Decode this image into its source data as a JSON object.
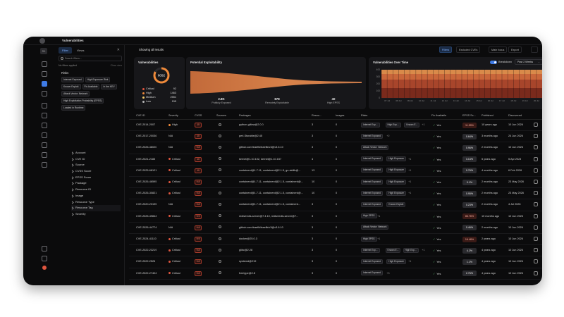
{
  "window": {
    "title": "Vulnerabilities"
  },
  "rail": {
    "badge": "S1"
  },
  "filters": {
    "tabs": [
      {
        "label": "Filter"
      },
      {
        "label": "Views"
      }
    ],
    "search_placeholder": "Search filters...",
    "applied": "No filters applied",
    "clear": "Clear view",
    "risks_header": "Risks",
    "risk_chips": [
      "Internet Exposed",
      "High Exposure Risk",
      "Known Exploit",
      "Fix Available",
      "In the KEV",
      "Attack Vector: Network",
      "High Exploitation Probability (EPSS)",
      "Loaded in Runtime"
    ],
    "groups": [
      "Account",
      "CVE ID",
      "Source",
      "CVSS Score",
      "EPSS Score",
      "Package",
      "Resource ID",
      "Image",
      "Resource Type",
      "Resource Tag",
      "Severity"
    ]
  },
  "toolbar": {
    "showing": "Showing all results",
    "buttons": [
      "Filters",
      "Excluded CVEs",
      "Main focus",
      "Export"
    ]
  },
  "vuln_card": {
    "title": "Vulnerabilities",
    "total": "6092",
    "legend": [
      {
        "label": "Critical",
        "value": "92",
        "color": "#e0563f"
      },
      {
        "label": "High",
        "value": "1463",
        "color": "#f08a3a"
      },
      {
        "label": "Medium",
        "value": "2551",
        "color": "#f3c969"
      },
      {
        "label": "Low",
        "value": "155",
        "color": "#b5b5b5"
      }
    ]
  },
  "exploit_card": {
    "title": "Potential Exploitability",
    "stats": [
      {
        "value": "2.8K",
        "label": "Publicly Exposed"
      },
      {
        "value": "878",
        "label": "Remotely Exploitable"
      },
      {
        "value": "40",
        "label": "High EPSS"
      }
    ]
  },
  "time_card": {
    "title": "Vulnerabilities Over Time",
    "breakdown_label": "Breakdown",
    "period": "Past 2 Weeks",
    "yticks": [
      "400",
      "300",
      "200",
      "100",
      "0"
    ],
    "xticks": [
      "07 Jul",
      "08 Jul",
      "09 Jul",
      "10 Jul",
      "11 Jul",
      "12 Jul",
      "13 Jul",
      "14 Jul",
      "15 Jul",
      "16 Jul",
      "17 Jul",
      "18 Jul",
      "19 Jul",
      "20 Jul"
    ],
    "series_colors": [
      "#7a2a1c",
      "#a8452b",
      "#c9663a",
      "#d98a4a"
    ]
  },
  "table": {
    "headers": [
      "CVE ID",
      "Severity",
      "CVSS",
      "Sources",
      "Packages",
      "Resou...",
      "Images",
      "Risks",
      "Fix Available",
      "EPSS Sc...",
      "Published",
      "Discovered"
    ],
    "rows": [
      {
        "cve": "CVE-2014-2007",
        "sev": "High",
        "sevc": "high",
        "cvss": "10",
        "pkg": "python-gitlow@2.0.0",
        "res": "3",
        "img": "0",
        "risks": [
          "Internet Exp...",
          "High Exp...",
          "Known E..."
        ],
        "more": "+1",
        "fix": "Yes",
        "epss": "11.59%",
        "hot": true,
        "pub": "10 years ago",
        "disc": "10 Jun 2026"
      },
      {
        "cve": "CVE-2017-20036",
        "sev": "N/A",
        "sevc": "na",
        "cvss": "10",
        "pkg": "perl-Storable@2.45",
        "res": "3",
        "img": "0",
        "risks": [
          "Internet Exposed"
        ],
        "more": "+2",
        "fix": "Yes",
        "epss": "0.64%",
        "hot": false,
        "pub": "3 months ago",
        "disc": "24 Jun 2026"
      },
      {
        "cve": "CVE-2026-48020",
        "sev": "N/A",
        "sevc": "na",
        "cvss": "9.8",
        "pkg": "github.com/traefik/traefik/v3@v3.6.10",
        "res": "3",
        "img": "0",
        "risks": [
          "Attack Vector: Network"
        ],
        "more": "",
        "fix": "Yes",
        "epss": "0.96%",
        "hot": false,
        "pub": "2 months ago",
        "disc": "10 Jun 2026"
      },
      {
        "cve": "CVE-2021-2183",
        "sev": "Critical",
        "sevc": "crit",
        "cvss": "10",
        "pkg": "kernel@1.10.102, kernel@1.10.157",
        "res": "4",
        "img": "0",
        "risks": [
          "Internet Exposed",
          "High Exposure"
        ],
        "more": "+1",
        "fix": "Yes",
        "epss": "3.14%",
        "hot": false,
        "pub": "5 years ago",
        "disc": "5 Apr 2024"
      },
      {
        "cve": "CVE-2025-68121",
        "sev": "Critical",
        "sevc": "crit",
        "cvss": "10",
        "pkg": "containerd@1.7.11, containerd@2.1.5, go-stdlib@...",
        "res": "13",
        "img": "0",
        "risks": [
          "Internet Exposed",
          "High Exposure"
        ],
        "more": "+1",
        "fix": "Yes",
        "epss": "0.76%",
        "hot": false,
        "pub": "4 months ago",
        "disc": "6 Feb 2026"
      },
      {
        "cve": "CVE-2026-46595",
        "sev": "Critical",
        "sevc": "crit",
        "cvss": "9.8",
        "pkg": "containerd@1.7.11, containerd@2.1.5, containerd@...",
        "res": "10",
        "img": "0",
        "risks": [
          "Internet Exposed",
          "High Exposure"
        ],
        "more": "+1",
        "fix": "Yes",
        "epss": "0.1%",
        "hot": false,
        "pub": "2 months ago",
        "disc": "23 May 2026"
      },
      {
        "cve": "CVE-2026-30821",
        "sev": "Critical",
        "sevc": "crit",
        "cvss": "9.8",
        "pkg": "containerd@1.7.11, containerd@2.1.5, containerd@...",
        "res": "10",
        "img": "0",
        "risks": [
          "Internet Exposed",
          "High Exposure"
        ],
        "more": "+1",
        "fix": "Yes",
        "epss": "0.95%",
        "hot": false,
        "pub": "2 months ago",
        "disc": "23 May 2026"
      },
      {
        "cve": "CVE-2020-20195",
        "sev": "N/A",
        "sevc": "na",
        "cvss": "9.8",
        "pkg": "containerd@1.7.11, containerd@2.1.5, containerd...",
        "res": "3",
        "img": "0",
        "risks": [
          "Internet Exposed",
          "Known Exploit"
        ],
        "more": "",
        "fix": "Yes",
        "epss": "0.23%",
        "hot": false,
        "pub": "2 months ago",
        "disc": "4 Jul 2026"
      },
      {
        "cve": "CVE-2025-49844",
        "sev": "Critical",
        "sevc": "crit",
        "cvss": "9.9",
        "pkg": "redis/redis-server@7.4.10, redis/redis-server@7...",
        "res": "3",
        "img": "0",
        "risks": [
          "High EPSS"
        ],
        "more": "+1",
        "fix": "Yes",
        "epss": "86.76%",
        "hot": true,
        "pub": "10 months ago",
        "disc": "10 Jun 2026"
      },
      {
        "cve": "CVE-2026-44774",
        "sev": "N/A",
        "sevc": "na",
        "cvss": "9.8",
        "pkg": "github.com/traefik/traefik/v3@v3.6.10",
        "res": "3",
        "img": "0",
        "risks": [
          "Attack Vector: Network"
        ],
        "more": "",
        "fix": "Yes",
        "epss": "0.46%",
        "hot": false,
        "pub": "2 months ago",
        "disc": "10 Jun 2026"
      },
      {
        "cve": "CVE-2024-41110",
        "sev": "Critical",
        "sevc": "crit",
        "cvss": "9.9",
        "pkg": "docker@25.0.3",
        "res": "3",
        "img": "0",
        "risks": [
          "High EPSS"
        ],
        "more": "+1",
        "fix": "Yes",
        "epss": "16.48%",
        "hot": true,
        "pub": "2 years ago",
        "disc": "10 Jun 2026"
      },
      {
        "cve": "CVE-2022-23219",
        "sev": "Critical",
        "sevc": "crit",
        "cvss": "9.8",
        "pkg": "glibc@2.28",
        "res": "3",
        "img": "0",
        "risks": [
          "Internet Exp...",
          "Known E...",
          "High Exp..."
        ],
        "more": "+1",
        "fix": "Yes",
        "epss": "4.2%",
        "hot": false,
        "pub": "4 years ago",
        "disc": "10 Jun 2026"
      },
      {
        "cve": "CVE-2022-2526",
        "sev": "Critical",
        "sevc": "crit",
        "cvss": "9.8",
        "pkg": "systemd@219",
        "res": "3",
        "img": "0",
        "risks": [
          "Internet Exposed",
          "High Exposure"
        ],
        "more": "+1",
        "fix": "Yes",
        "epss": "1.1%",
        "hot": false,
        "pub": "4 years ago",
        "disc": "10 Jun 2026"
      },
      {
        "cve": "CVE-2022-27404",
        "sev": "Critical",
        "sevc": "crit",
        "cvss": "9.8",
        "pkg": "freetype@2.8",
        "res": "3",
        "img": "0",
        "risks": [
          "Internet Exposed"
        ],
        "more": "+3",
        "fix": "Yes",
        "epss": "2.76%",
        "hot": false,
        "pub": "4 years ago",
        "disc": "10 Jun 2026"
      }
    ]
  }
}
